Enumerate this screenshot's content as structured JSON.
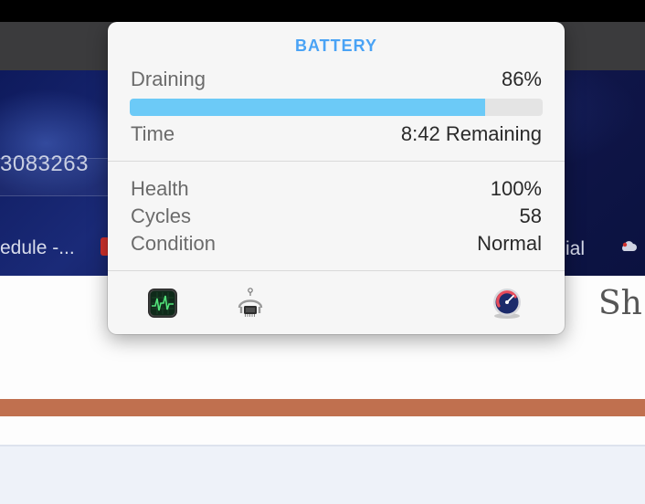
{
  "background": {
    "id_partial": "3083263",
    "bookmarks": {
      "schedule": "edule -...",
      "social": "ial"
    },
    "page_heading": "Sh"
  },
  "battery_popover": {
    "title": "BATTERY",
    "status_label": "Draining",
    "charge_percent_text": "86%",
    "charge_fraction": 0.86,
    "time_label": "Time",
    "time_value": "8:42 Remaining",
    "health_label": "Health",
    "health_value": "100%",
    "cycles_label": "Cycles",
    "cycles_value": "58",
    "condition_label": "Condition",
    "condition_value": "Normal",
    "apps": [
      {
        "name": "activity-monitor-icon"
      },
      {
        "name": "system-information-icon"
      },
      {
        "name": "coconut-battery-icon"
      }
    ]
  },
  "colors": {
    "accent": "#4aa3f5",
    "progress_fill": "#6ccaf7",
    "copper_bar": "#c0704f"
  }
}
